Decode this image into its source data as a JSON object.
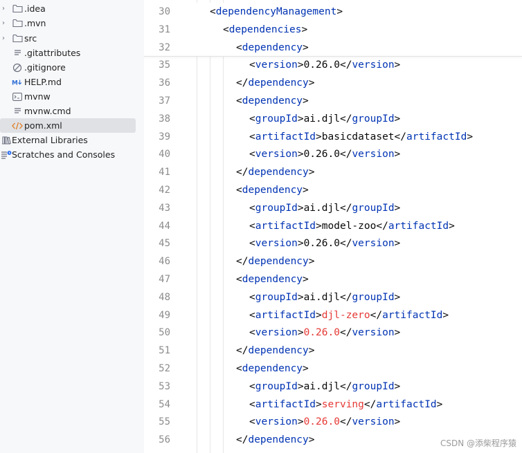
{
  "project_tree": {
    "items": [
      {
        "label": ".idea",
        "icon": "folder-icon",
        "expandable": true
      },
      {
        "label": ".mvn",
        "icon": "folder-icon",
        "expandable": true
      },
      {
        "label": "src",
        "icon": "folder-icon",
        "expandable": true
      },
      {
        "label": ".gitattributes",
        "icon": "text-file-icon",
        "expandable": false
      },
      {
        "label": ".gitignore",
        "icon": "ignore-file-icon",
        "expandable": false
      },
      {
        "label": "HELP.md",
        "icon": "markdown-file-icon",
        "expandable": false
      },
      {
        "label": "mvnw",
        "icon": "shell-file-icon",
        "expandable": false
      },
      {
        "label": "mvnw.cmd",
        "icon": "text-file-icon",
        "expandable": false
      },
      {
        "label": "pom.xml",
        "icon": "xml-file-icon",
        "expandable": false,
        "selected": true
      },
      {
        "label": "External Libraries",
        "icon": "libraries-icon",
        "expandable": false
      },
      {
        "label": "Scratches and Consoles",
        "icon": "scratches-icon",
        "expandable": false
      }
    ]
  },
  "editor": {
    "lines": [
      {
        "num": "30",
        "indent": 0,
        "tag": "dependencyManagement",
        "kind": "open"
      },
      {
        "num": "31",
        "indent": 1,
        "tag": "dependencies",
        "kind": "open"
      },
      {
        "num": "32",
        "indent": 2,
        "tag": "dependency",
        "kind": "open"
      },
      {
        "num": "35",
        "indent": 3,
        "tag": "version",
        "kind": "elem",
        "text": "0.26.0",
        "error": false
      },
      {
        "num": "36",
        "indent": 2,
        "tag": "dependency",
        "kind": "close"
      },
      {
        "num": "37",
        "indent": 2,
        "tag": "dependency",
        "kind": "open"
      },
      {
        "num": "38",
        "indent": 3,
        "tag": "groupId",
        "kind": "elem",
        "text": "ai.djl",
        "error": false
      },
      {
        "num": "39",
        "indent": 3,
        "tag": "artifactId",
        "kind": "elem",
        "text": "basicdataset",
        "error": false
      },
      {
        "num": "40",
        "indent": 3,
        "tag": "version",
        "kind": "elem",
        "text": "0.26.0",
        "error": false
      },
      {
        "num": "41",
        "indent": 2,
        "tag": "dependency",
        "kind": "close"
      },
      {
        "num": "42",
        "indent": 2,
        "tag": "dependency",
        "kind": "open"
      },
      {
        "num": "43",
        "indent": 3,
        "tag": "groupId",
        "kind": "elem",
        "text": "ai.djl",
        "error": false
      },
      {
        "num": "44",
        "indent": 3,
        "tag": "artifactId",
        "kind": "elem",
        "text": "model-zoo",
        "error": false
      },
      {
        "num": "45",
        "indent": 3,
        "tag": "version",
        "kind": "elem",
        "text": "0.26.0",
        "error": false
      },
      {
        "num": "46",
        "indent": 2,
        "tag": "dependency",
        "kind": "close"
      },
      {
        "num": "47",
        "indent": 2,
        "tag": "dependency",
        "kind": "open"
      },
      {
        "num": "48",
        "indent": 3,
        "tag": "groupId",
        "kind": "elem",
        "text": "ai.djl",
        "error": false
      },
      {
        "num": "49",
        "indent": 3,
        "tag": "artifactId",
        "kind": "elem",
        "text": "djl-zero",
        "error": true
      },
      {
        "num": "50",
        "indent": 3,
        "tag": "version",
        "kind": "elem",
        "text": "0.26.0",
        "error": true
      },
      {
        "num": "51",
        "indent": 2,
        "tag": "dependency",
        "kind": "close"
      },
      {
        "num": "52",
        "indent": 2,
        "tag": "dependency",
        "kind": "open"
      },
      {
        "num": "53",
        "indent": 3,
        "tag": "groupId",
        "kind": "elem",
        "text": "ai.djl",
        "error": false
      },
      {
        "num": "54",
        "indent": 3,
        "tag": "artifactId",
        "kind": "elem",
        "text": "serving",
        "error": true
      },
      {
        "num": "55",
        "indent": 3,
        "tag": "version",
        "kind": "elem",
        "text": "0.26.0",
        "error": true
      },
      {
        "num": "56",
        "indent": 2,
        "tag": "dependency",
        "kind": "close"
      }
    ]
  },
  "watermark": "CSDN @添柴程序猿",
  "colors": {
    "tag": "#0033b3",
    "text": "#080808",
    "error": "#e53935",
    "line_number": "#8c8c8c",
    "selection": "#dfe1e5"
  }
}
